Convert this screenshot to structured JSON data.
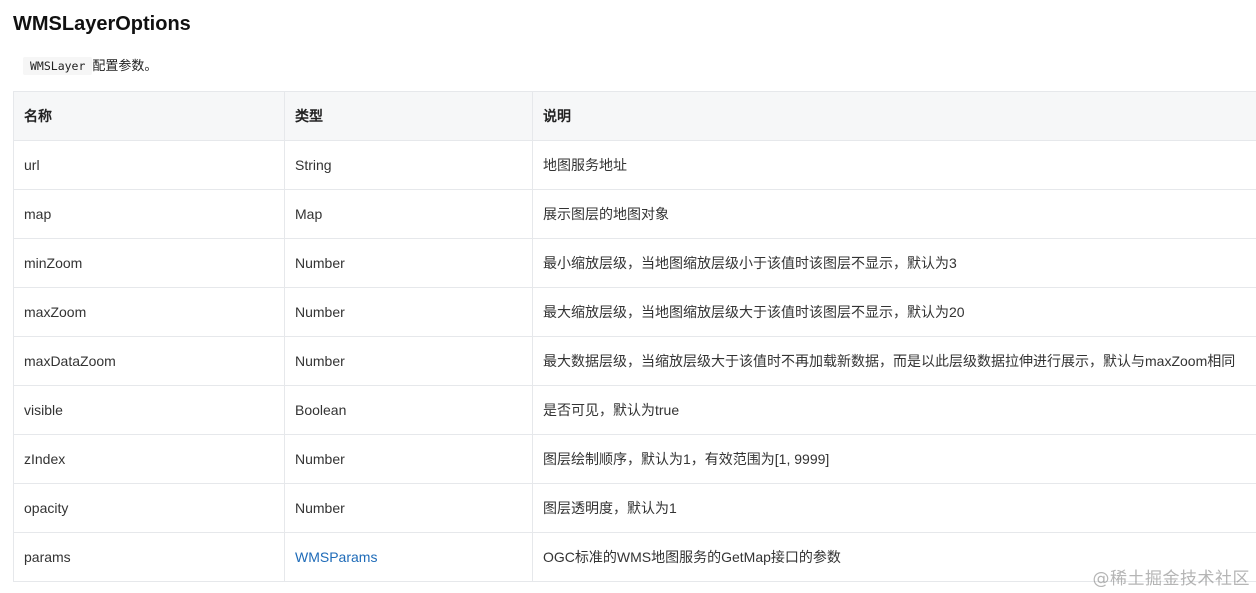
{
  "title": "WMSLayerOptions",
  "intro": {
    "code": "WMSLayer",
    "text": "配置参数。"
  },
  "table": {
    "headers": [
      "名称",
      "类型",
      "说明"
    ],
    "rows": [
      {
        "name": "url",
        "type": "String",
        "desc": "地图服务地址"
      },
      {
        "name": "map",
        "type": "Map",
        "desc": "展示图层的地图对象"
      },
      {
        "name": "minZoom",
        "type": "Number",
        "desc": "最小缩放层级，当地图缩放层级小于该值时该图层不显示，默认为3"
      },
      {
        "name": "maxZoom",
        "type": "Number",
        "desc": "最大缩放层级，当地图缩放层级大于该值时该图层不显示，默认为20"
      },
      {
        "name": "maxDataZoom",
        "type": "Number",
        "desc": "最大数据层级，当缩放层级大于该值时不再加载新数据，而是以此层级数据拉伸进行展示，默认与maxZoom相同"
      },
      {
        "name": "visible",
        "type": "Boolean",
        "desc": "是否可见，默认为true"
      },
      {
        "name": "zIndex",
        "type": "Number",
        "desc": "图层绘制顺序，默认为1，有效范围为[1, 9999]"
      },
      {
        "name": "opacity",
        "type": "Number",
        "desc": "图层透明度，默认为1"
      },
      {
        "name": "params",
        "type": "WMSParams",
        "desc": "OGC标准的WMS地图服务的GetMap接口的参数"
      }
    ]
  },
  "watermark": "@稀土掘金技术社区"
}
